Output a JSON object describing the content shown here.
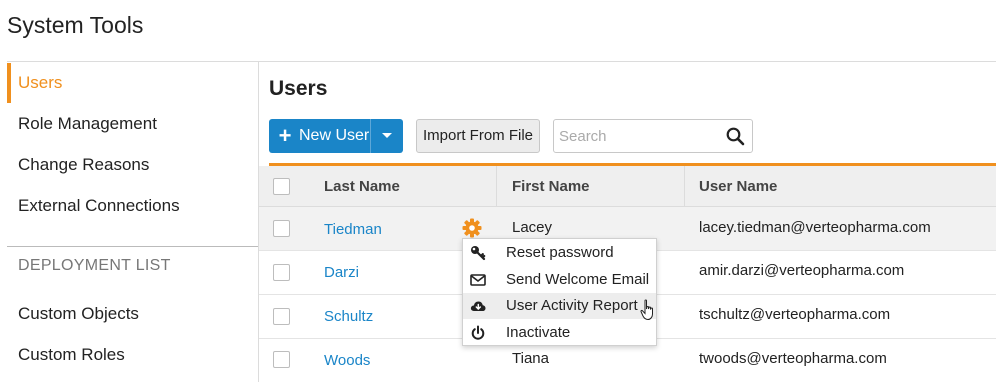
{
  "app": {
    "title": "System Tools"
  },
  "sidebar": {
    "items": [
      {
        "label": "Users",
        "active": true
      },
      {
        "label": "Role Management"
      },
      {
        "label": "Change Reasons"
      },
      {
        "label": "External Connections"
      }
    ],
    "section_heading": "DEPLOYMENT LIST",
    "deployment_items": [
      {
        "label": "Custom Objects"
      },
      {
        "label": "Custom Roles"
      }
    ]
  },
  "main": {
    "title": "Users",
    "toolbar": {
      "new_user_label": "New User",
      "import_label": "Import From File",
      "search_placeholder": "Search",
      "search_value": ""
    },
    "table": {
      "columns": [
        "Last Name",
        "First Name",
        "User Name"
      ],
      "rows": [
        {
          "last": "Tiedman",
          "first": "Lacey",
          "username": "lacey.tiedman@verteopharma.com"
        },
        {
          "last": "Darzi",
          "first": "",
          "username": "amir.darzi@verteopharma.com"
        },
        {
          "last": "Schultz",
          "first": "",
          "username": "tschultz@verteopharma.com"
        },
        {
          "last": "Woods",
          "first": "Tiana",
          "username": "twoods@verteopharma.com"
        }
      ]
    },
    "context_menu": {
      "items": [
        {
          "label": "Reset password",
          "icon": "key-icon"
        },
        {
          "label": "Send Welcome Email",
          "icon": "envelope-icon"
        },
        {
          "label": "User Activity Report",
          "icon": "cloud-download-icon",
          "hovered": true
        },
        {
          "label": "Inactivate",
          "icon": "power-icon"
        }
      ]
    }
  },
  "colors": {
    "accent": "#f0901e",
    "primary": "#1a85c8",
    "link": "#1a85c8"
  }
}
